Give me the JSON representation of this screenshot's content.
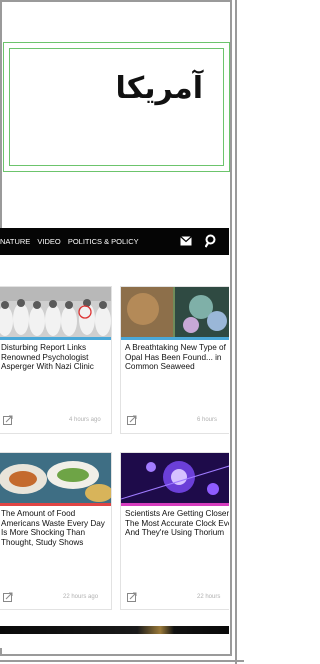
{
  "title_box": {
    "title": "آمریکا"
  },
  "embed": {
    "nav": {
      "links": [
        "NATURE",
        "VIDEO",
        "POLITICS & POLICY"
      ],
      "icons": [
        "mail-icon",
        "search-icon"
      ]
    },
    "cards": [
      {
        "title": "Disturbing Report Links Renowned Psychologist Asperger With Nazi Clinic",
        "time": "4 hours ago",
        "bar_color": "#4aa8d8"
      },
      {
        "title": "A Breathtaking New Type of Opal Has Been Found... in Common Seaweed",
        "time": "6 hours",
        "bar_color": "#4aa8d8"
      },
      {
        "title": "The Amount of Food Americans Waste Every Day Is More Shocking Than Thought, Study Shows",
        "time": "22 hours ago",
        "bar_color": "#e04444"
      },
      {
        "title": "Scientists Are Getting Closer to The Most Accurate Clock Ever, And They're Using Thorium",
        "time": "22 hours",
        "bar_color": "#d63cbf"
      }
    ]
  },
  "colors": {
    "frame": "#9a9a9a",
    "title_border": "#6cc46c",
    "navbar": "#050505"
  }
}
